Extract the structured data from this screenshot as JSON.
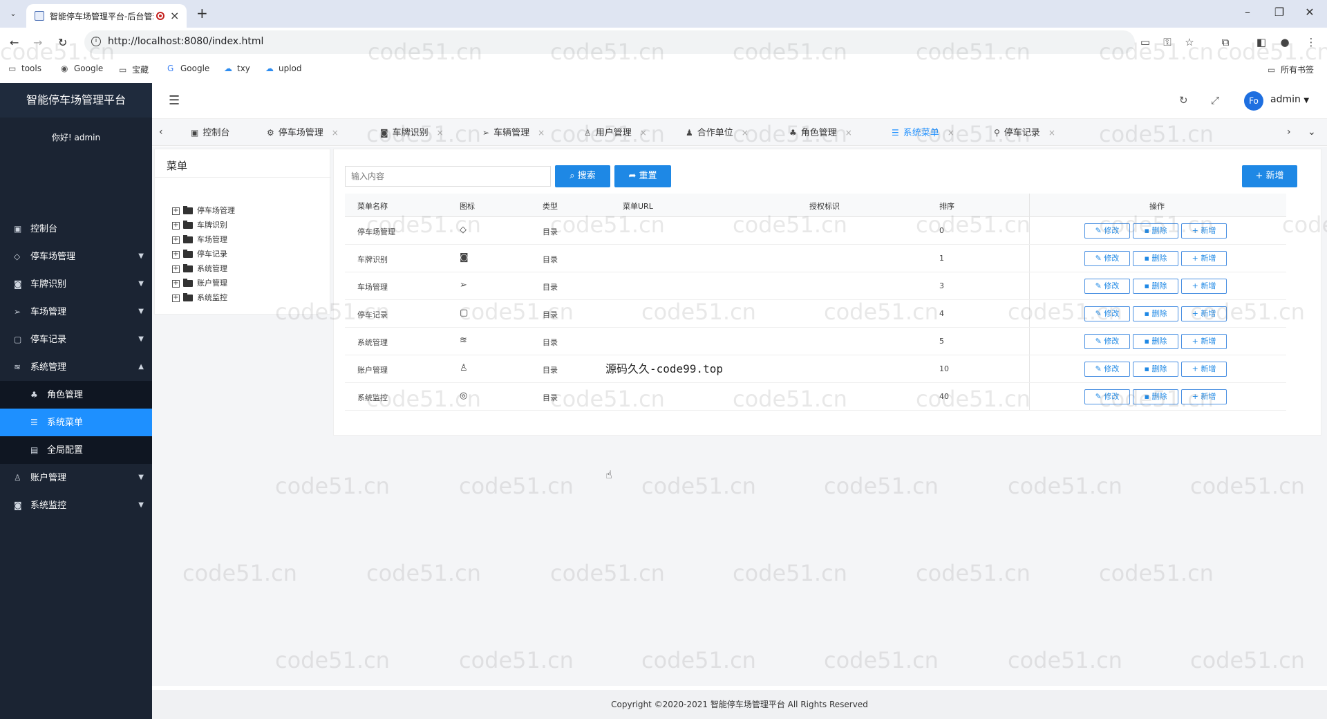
{
  "browser": {
    "tab_title": "智能停车场管理平台-后台管理",
    "url": "http://localhost:8080/index.html",
    "bookmarks": [
      {
        "label": "tools",
        "icon": "folder-icon"
      },
      {
        "label": "Google",
        "icon": "globe-icon"
      },
      {
        "label": "宝藏",
        "icon": "folder-icon"
      },
      {
        "label": "Google",
        "icon": "google-icon"
      },
      {
        "label": "txy",
        "icon": "cloud-icon"
      },
      {
        "label": "uplod",
        "icon": "cloud-icon"
      }
    ],
    "all_bookmarks": "所有书签"
  },
  "app": {
    "brand": "智能停车场管理平台",
    "welcome": "你好! admin",
    "user": "admin",
    "avatar_text": "Fo"
  },
  "menu": {
    "items": [
      {
        "label": "控制台",
        "icon": "monitor-icon"
      },
      {
        "label": "停车场管理",
        "icon": "diamond-icon"
      },
      {
        "label": "车牌识别",
        "icon": "camera-icon"
      },
      {
        "label": "车场管理",
        "icon": "send-icon"
      },
      {
        "label": "停车记录",
        "icon": "note-icon"
      },
      {
        "label": "系统管理",
        "icon": "layers-icon"
      }
    ],
    "sub_items": [
      {
        "label": "角色管理",
        "icon": "tree-icon"
      },
      {
        "label": "系统菜单",
        "icon": "list-icon"
      },
      {
        "label": "全局配置",
        "icon": "config-icon"
      }
    ],
    "bottom_items": [
      {
        "label": "账户管理",
        "icon": "user-icon"
      },
      {
        "label": "系统监控",
        "icon": "camera-icon"
      }
    ]
  },
  "tabs": [
    {
      "label": "控制台"
    },
    {
      "label": "停车场管理"
    },
    {
      "label": "车牌识别"
    },
    {
      "label": "车辆管理"
    },
    {
      "label": "用户管理"
    },
    {
      "label": "合作单位"
    },
    {
      "label": "角色管理"
    },
    {
      "label": "系统菜单"
    },
    {
      "label": "停车记录"
    }
  ],
  "tree": {
    "title": "菜单",
    "nodes": [
      "停车场管理",
      "车牌识别",
      "车场管理",
      "停车记录",
      "系统管理",
      "账户管理",
      "系统监控"
    ]
  },
  "search": {
    "placeholder": "输入内容",
    "search_label": "搜索",
    "reset_label": "重置",
    "add_label": "新增"
  },
  "table": {
    "headers": [
      "菜单名称",
      "图标",
      "类型",
      "菜单URL",
      "授权标识",
      "排序",
      "操作"
    ],
    "rows": [
      {
        "name": "停车场管理",
        "icon": "diamond-icon",
        "type": "目录",
        "url": "",
        "perm": "",
        "order": "0"
      },
      {
        "name": "车牌识别",
        "icon": "camera-icon",
        "type": "目录",
        "url": "",
        "perm": "",
        "order": "1"
      },
      {
        "name": "车场管理",
        "icon": "send-icon",
        "type": "目录",
        "url": "",
        "perm": "",
        "order": "3"
      },
      {
        "name": "停车记录",
        "icon": "note-icon",
        "type": "目录",
        "url": "",
        "perm": "",
        "order": "4"
      },
      {
        "name": "系统管理",
        "icon": "layers-icon",
        "type": "目录",
        "url": "",
        "perm": "",
        "order": "5"
      },
      {
        "name": "账户管理",
        "icon": "user-icon",
        "type": "目录",
        "url": "",
        "perm": "",
        "order": "10"
      },
      {
        "name": "系统监控",
        "icon": "camera-icon",
        "type": "目录",
        "url": "",
        "perm": "",
        "order": "40"
      }
    ],
    "actions": {
      "edit": "修改",
      "delete": "删除",
      "add": "新增"
    }
  },
  "overlay_text": "源码久久-code99.top",
  "watermark": "code51.cn",
  "footer": "Copyright ©2020-2021 智能停车场管理平台 All Rights Reserved",
  "colors": {
    "sidebar": "#1b2433",
    "accent": "#1e88e5",
    "active_menu": "#1e90ff"
  }
}
